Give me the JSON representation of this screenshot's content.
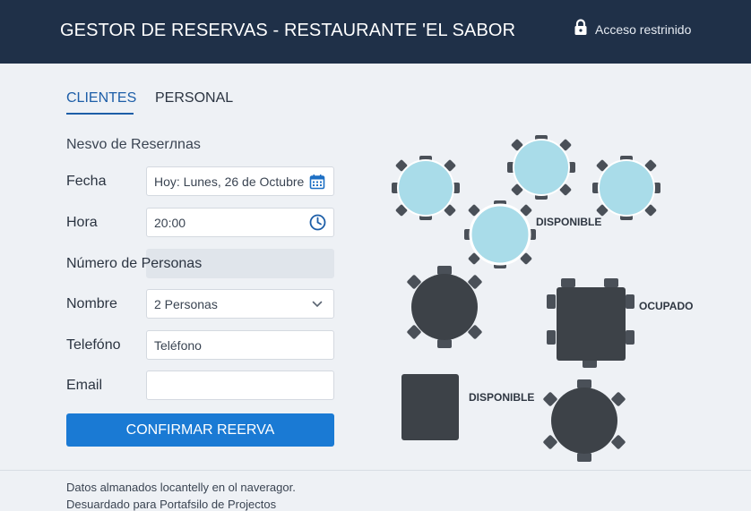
{
  "header": {
    "title": "GESTOR DE RESERVAS - RESTAURANTE 'EL SABOR",
    "access_label": "Acceso restrinido"
  },
  "tabs": [
    {
      "label": "CLIENTES",
      "active": true
    },
    {
      "label": "PERSONAL",
      "active": false
    }
  ],
  "form": {
    "section_title": "Nesvo de Reserлnas",
    "fecha": {
      "label": "Fecha",
      "value": "Hoy: Lunes, 26 de Octubre"
    },
    "hora": {
      "label": "Hora",
      "value": "20:00"
    },
    "personas": {
      "label": "Número de Personas"
    },
    "nombre": {
      "label": "Nombre",
      "value": "2 Personas"
    },
    "telefono": {
      "label": "Telefóno",
      "placeholder": "Teléfono"
    },
    "email": {
      "label": "Email",
      "value": ""
    },
    "confirm_label": "CONFIRMAR REERVA"
  },
  "floor_plan": {
    "status_labels": {
      "disponible_top": "DISPONIBLE",
      "ocupado": "OCUPADO",
      "disponible_bottom": "DISPONIBLE"
    },
    "colors": {
      "available": "#a9dce9",
      "occupied": "#3d4248",
      "chair": "#4a5058"
    }
  },
  "footer": {
    "line1": "Datos almanados locantelly en ol naveragor.",
    "line2": "Desuardado para Portafsilo de Projectos"
  }
}
